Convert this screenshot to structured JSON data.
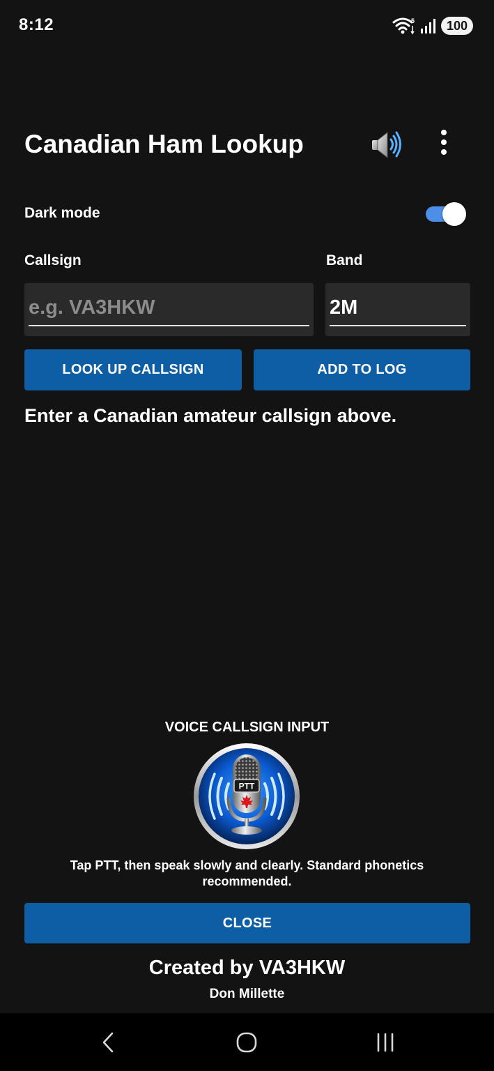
{
  "status_bar": {
    "time": "8:12",
    "battery": "100",
    "icons": [
      "wifi-icon",
      "signal-icon",
      "battery-icon"
    ]
  },
  "app_bar": {
    "title": "Canadian Ham Lookup",
    "actions": [
      "speaker-icon",
      "overflow-menu-icon"
    ]
  },
  "settings": {
    "dark_mode_label": "Dark mode",
    "dark_mode_on": true
  },
  "form": {
    "callsign_label": "Callsign",
    "callsign_value": "",
    "callsign_placeholder": "e.g. VA3HKW",
    "band_label": "Band",
    "band_value": "2M"
  },
  "actions": {
    "lookup_label": "LOOK UP CALLSIGN",
    "add_log_label": "ADD TO LOG"
  },
  "result": {
    "message": "Enter a Canadian amateur callsign above."
  },
  "voice": {
    "title": "VOICE CALLSIGN INPUT",
    "ptt_label": "PTT",
    "instructions": "Tap PTT, then speak slowly and clearly. Standard phonetics recommended.",
    "close_label": "CLOSE"
  },
  "footer": {
    "credit": "Created by VA3HKW",
    "author": "Don Millette"
  },
  "navigation": [
    "back-icon",
    "home-icon",
    "recents-icon"
  ],
  "colors": {
    "background": "#131313",
    "primary_button": "#0e5ea5",
    "switch_track": "#4d8fe8",
    "input_background": "#2a2a2a"
  }
}
